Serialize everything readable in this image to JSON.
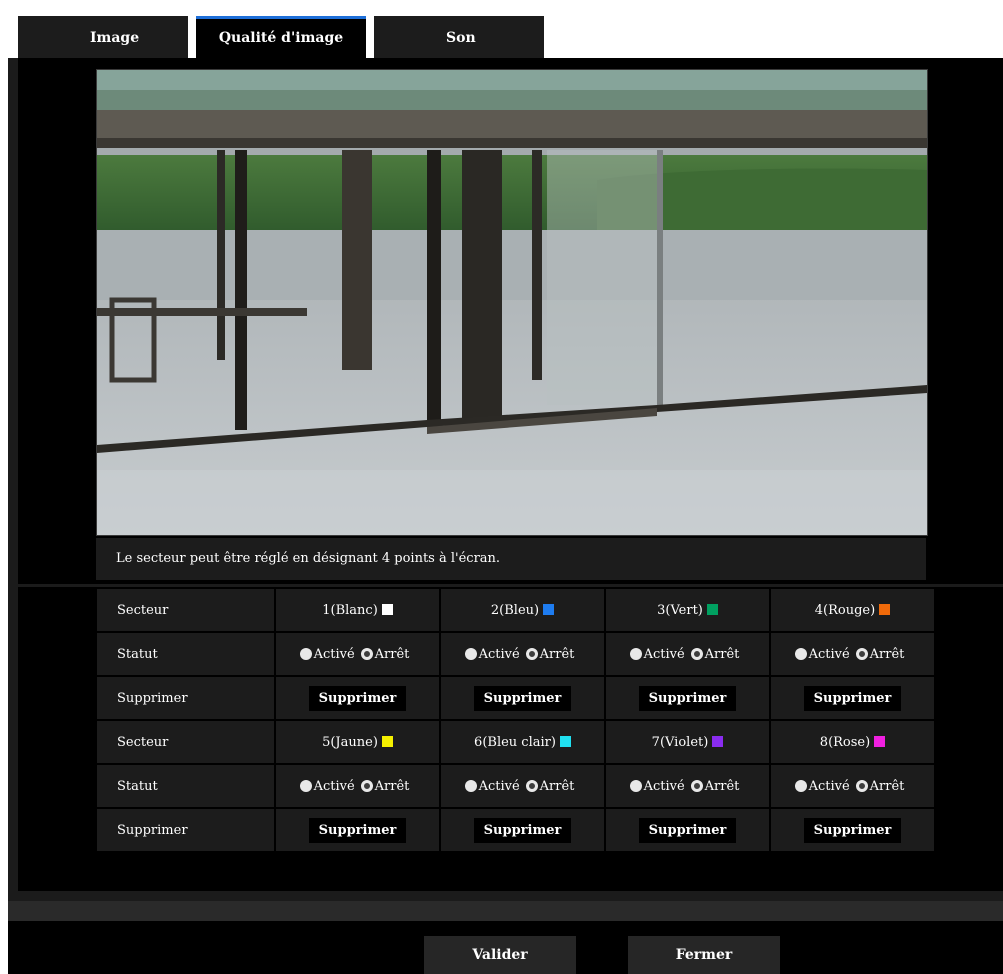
{
  "tabs": [
    {
      "label": "Image"
    },
    {
      "label": "Qualité d'image"
    },
    {
      "label": "Son"
    }
  ],
  "caption": "Le secteur peut être réglé en désignant 4 points à l'écran.",
  "rows": {
    "secteur_label": "Secteur",
    "statut_label": "Statut",
    "supprimer_label": "Supprimer"
  },
  "areas": [
    {
      "name": "1(Blanc)",
      "color": "#ffffff"
    },
    {
      "name": "2(Bleu)",
      "color": "#1e7cf0"
    },
    {
      "name": "3(Vert)",
      "color": "#00a060"
    },
    {
      "name": "4(Rouge)",
      "color": "#f06a0a"
    },
    {
      "name": "5(Jaune)",
      "color": "#f5f000"
    },
    {
      "name": "6(Bleu clair)",
      "color": "#20e0f0"
    },
    {
      "name": "7(Violet)",
      "color": "#8a2cf0"
    },
    {
      "name": "8(Rose)",
      "color": "#f020e0"
    }
  ],
  "radio": {
    "on": "Activé",
    "off": "Arrêt",
    "selected": "off"
  },
  "delete_button": "Supprimer",
  "buttons": {
    "valider": "Valider",
    "fermer": "Fermer"
  }
}
